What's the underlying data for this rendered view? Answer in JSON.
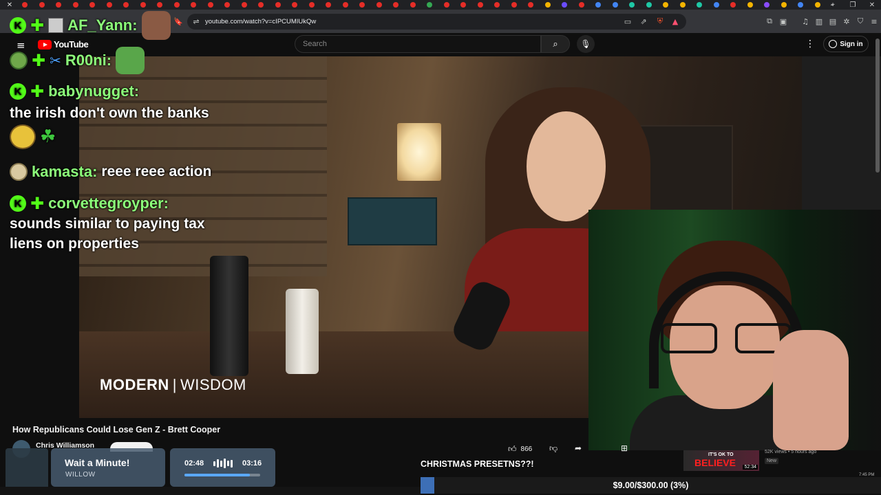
{
  "browser": {
    "tab_favicons": [
      "#e52d27",
      "#e52d27",
      "#e52d27",
      "#e52d27",
      "#e52d27",
      "#e52d27",
      "#e52d27",
      "#e52d27",
      "#e52d27",
      "#e52d27",
      "#e52d27",
      "#e52d27",
      "#e52d27",
      "#e52d27",
      "#e52d27",
      "#e52d27",
      "#e52d27",
      "#e52d27",
      "#e52d27",
      "#e52d27",
      "#e52d27",
      "#e52d27",
      "#e52d27",
      "#e52d27",
      "#34a853",
      "#e52d27",
      "#e52d27",
      "#e52d27",
      "#e52d27",
      "#e52d27",
      "#e52d27",
      "#f4b400",
      "#6a4cff",
      "#e52d27",
      "#4285f4",
      "#4285f4",
      "#1ec8a5",
      "#1ec8a5",
      "#f4b400",
      "#f4b400",
      "#1ec8a5",
      "#4285f4",
      "#e52d27",
      "#f4b400",
      "#8a4cff",
      "#f4b400",
      "#4285f4",
      "#f4b400"
    ],
    "new_tab_symbol": "+",
    "url": "youtube.com/watch?v=cIPCUMIUkQw"
  },
  "youtube": {
    "logo_text": "YouTube",
    "search_placeholder": "Search",
    "sign_in": "Sign in",
    "video_title": "How Republicans Could Lose Gen Z - Brett Cooper",
    "channel_name": "Chris Williamson",
    "like_count": "866",
    "watermark_left": "MODERN",
    "watermark_right": "WISDOM",
    "recommended": {
      "thumb_line1": "IT'S OK TO",
      "thumb_line2": "BELIEVE",
      "duration": "52:34",
      "meta": "52K views • 5 hours ago",
      "badge": "New"
    }
  },
  "chat": [
    {
      "user": "AF_Yann:",
      "message": ""
    },
    {
      "user": "R00ni:",
      "message": ""
    },
    {
      "user": "babynugget:",
      "message": "the irish don't own the banks"
    },
    {
      "user": "kamasta:",
      "message": "reee reee action"
    },
    {
      "user": "corvettegroyper:",
      "message": "sounds similar to paying tax",
      "message2": "liens on properties"
    }
  ],
  "music_widget": {
    "title": "Wait a Minute!",
    "artist": "WILLOW",
    "elapsed": "02:48",
    "total": "03:16",
    "progress_fraction": 0.86
  },
  "goal": {
    "title": "CHRISTMAS PRESETNS??!",
    "label": "$9.00/$300.00 (3%)",
    "fraction": 0.03
  },
  "clock": "7:45 PM",
  "colors": {
    "kick_green": "#53fc18",
    "username_green": "#8cff7a",
    "goal_fill": "#3d6fb6",
    "yt_red": "#ff0000"
  }
}
